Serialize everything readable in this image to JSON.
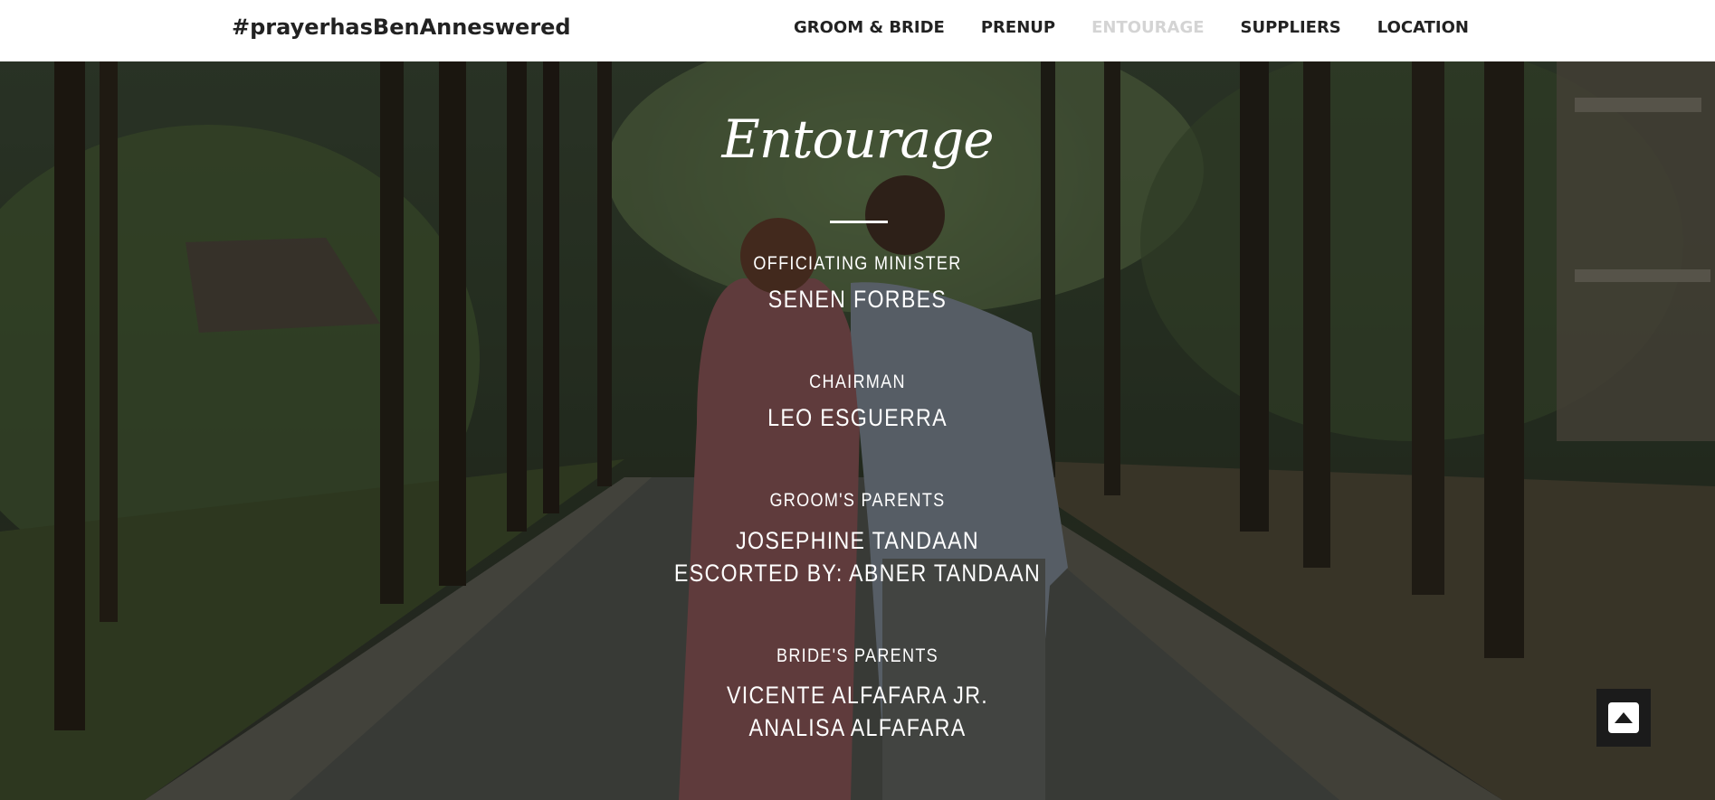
{
  "navbar": {
    "brand": "#prayerhasBenAnneswered",
    "links": [
      {
        "label": "GROOM & BRIDE",
        "active": false
      },
      {
        "label": "PRENUP",
        "active": false
      },
      {
        "label": "ENTOURAGE",
        "active": true
      },
      {
        "label": "SUPPLIERS",
        "active": false
      },
      {
        "label": "LOCATION",
        "active": false
      }
    ]
  },
  "entourage": {
    "title": "Entourage",
    "groups": [
      {
        "role": "OFFICIATING MINISTER",
        "names": [
          "SENEN FORBES"
        ]
      },
      {
        "role": "CHAIRMAN",
        "names": [
          "LEO ESGUERRA"
        ]
      },
      {
        "role": "GROOM'S PARENTS",
        "names": [
          "JOSEPHINE TANDAAN",
          "ESCORTED BY: ABNER TANDAAN"
        ]
      },
      {
        "role": "BRIDE'S PARENTS",
        "names": [
          "VICENTE ALFAFARA JR.",
          "ANALISA ALFAFARA"
        ]
      }
    ]
  },
  "back_to_top": {
    "icon": "caret-up-square-icon"
  },
  "colors": {
    "navbar_bg": "#ffffff",
    "nav_text": "#222222",
    "nav_active": "#d4d4d4",
    "content_text": "#ffffff",
    "back_to_top_bg": "#1b1b1b"
  }
}
